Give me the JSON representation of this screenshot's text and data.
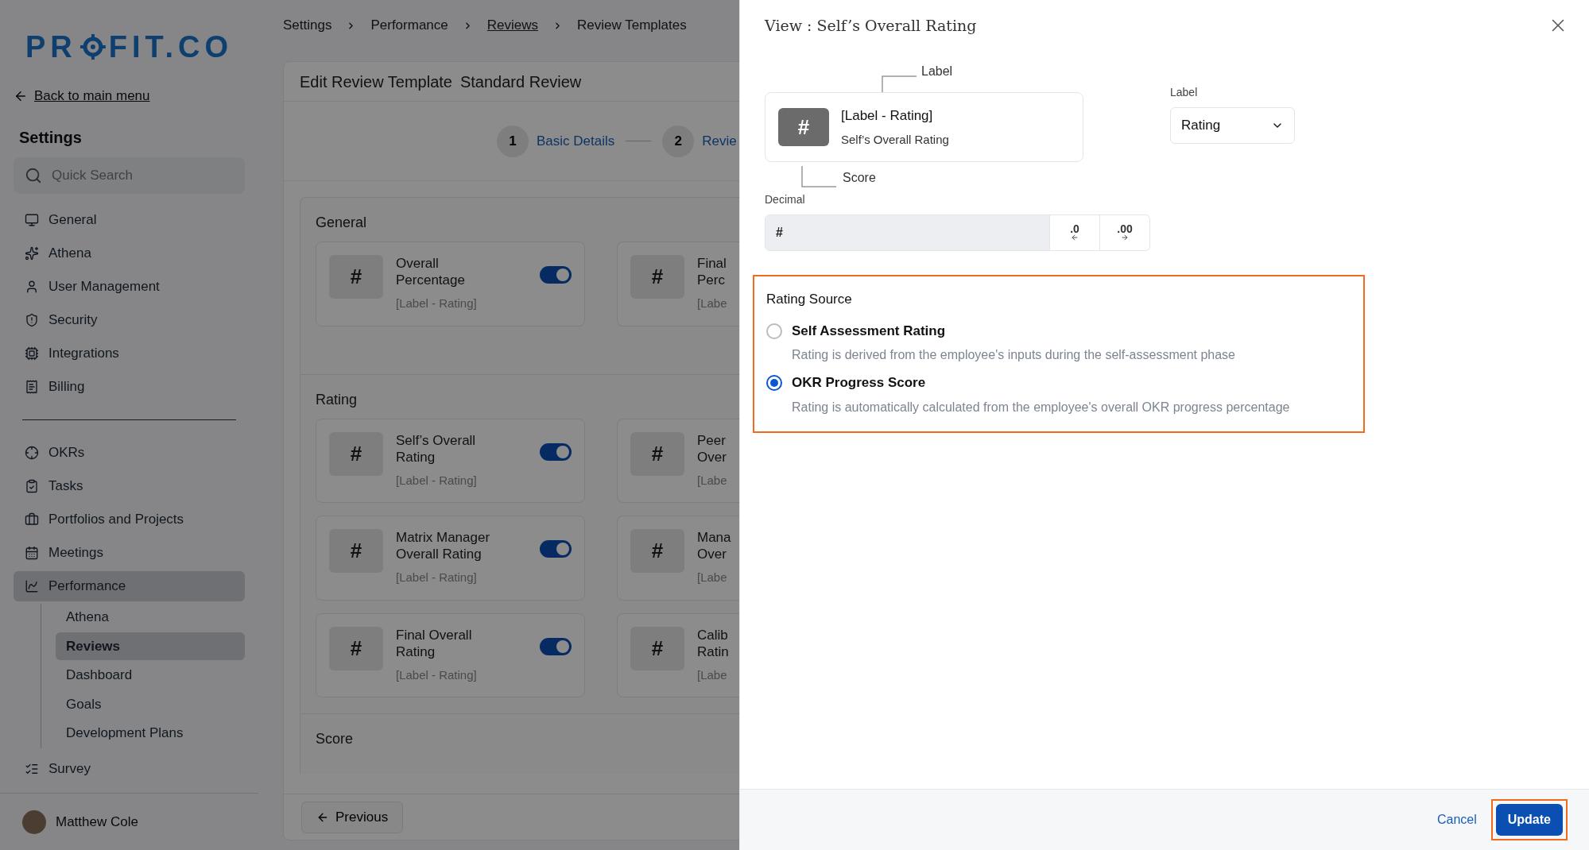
{
  "sidebar": {
    "logo_parts": [
      "PR",
      "FIT.CO"
    ],
    "back_link": "Back to main menu",
    "heading": "Settings",
    "search": {
      "placeholder": "Quick Search"
    },
    "items": [
      {
        "label": "General",
        "selected": false
      },
      {
        "label": "Athena",
        "selected": false
      },
      {
        "label": "User Management",
        "selected": false
      },
      {
        "label": "Security",
        "selected": false
      },
      {
        "label": "Integrations",
        "selected": false
      },
      {
        "label": "Billing",
        "selected": false
      }
    ],
    "items2": [
      {
        "label": "OKRs",
        "selected": false
      },
      {
        "label": "Tasks",
        "selected": false
      },
      {
        "label": "Portfolios and Projects",
        "selected": false
      },
      {
        "label": "Meetings",
        "selected": false
      },
      {
        "label": "Performance",
        "selected": true,
        "expanded": true,
        "children": [
          {
            "label": "Athena",
            "selected": false
          },
          {
            "label": "Reviews",
            "selected": true
          },
          {
            "label": "Dashboard",
            "selected": false
          },
          {
            "label": "Goals",
            "selected": false
          },
          {
            "label": "Development Plans",
            "selected": false
          }
        ]
      },
      {
        "label": "Survey",
        "selected": false
      }
    ],
    "user": {
      "name": "Matthew Cole"
    }
  },
  "breadcrumb": [
    {
      "label": "Settings",
      "link": false
    },
    {
      "label": "Performance",
      "link": false
    },
    {
      "label": "Reviews",
      "link": true
    },
    {
      "label": "Review Templates",
      "link": false
    }
  ],
  "editor": {
    "title": "Edit Review Template",
    "template_name": "Standard Review",
    "steps": [
      {
        "number": "1",
        "label": "Basic Details"
      },
      {
        "number": "2",
        "label": "Revie"
      }
    ],
    "sections": [
      {
        "title": "General",
        "rows": [
          {
            "left": {
              "symbol": "#",
              "title": "Overall Percentage",
              "subtitle": "[Label - Rating]",
              "on": true
            },
            "right": {
              "symbol": "#",
              "title_lines": [
                "Final",
                "Perc"
              ],
              "subtitle": "[Labe"
            }
          }
        ]
      },
      {
        "title": "Rating",
        "rows": [
          {
            "left": {
              "symbol": "#",
              "title": "Self’s Overall Rating",
              "subtitle": "[Label - Rating]",
              "on": true
            },
            "right": {
              "symbol": "#",
              "title_lines": [
                "Peer",
                "Over"
              ],
              "subtitle": "[Labe"
            }
          },
          {
            "left": {
              "symbol": "#",
              "title": "Matrix Manager Overall Rating",
              "subtitle": "[Label - Rating]",
              "on": true
            },
            "right": {
              "symbol": "#",
              "title_lines": [
                "Mana",
                "Over"
              ],
              "subtitle": "[Labe"
            }
          },
          {
            "left": {
              "symbol": "#",
              "title": "Final Overall Rating",
              "subtitle": "[Label - Rating]",
              "on": true
            },
            "right": {
              "symbol": "#",
              "title_lines": [
                "Calib",
                "Ratin"
              ],
              "subtitle": "[Labe"
            }
          }
        ]
      },
      {
        "title": "Score"
      }
    ],
    "previous_button": "Previous"
  },
  "drawer": {
    "title": "View : Self’s Overall Rating",
    "preview": {
      "label_annotation": "Label",
      "symbol": "#",
      "label_text": "[Label - Rating]",
      "name": "Self’s Overall Rating",
      "score_annotation": "Score"
    },
    "label_field": {
      "label": "Label",
      "value": "Rating"
    },
    "decimal": {
      "label": "Decimal",
      "value": "#",
      "buttons": [
        ".0",
        ".00"
      ]
    },
    "rating_source": {
      "title": "Rating Source",
      "highlighted": true,
      "options": [
        {
          "label": "Self Assessment Rating",
          "description": "Rating is derived from the employee's inputs during the self-assessment phase",
          "selected": false
        },
        {
          "label": "OKR Progress Score",
          "description": "Rating is automatically calculated from the employee's overall OKR progress percentage",
          "selected": true
        }
      ]
    },
    "cancel": "Cancel",
    "update": {
      "label": "Update",
      "highlighted": true
    }
  }
}
